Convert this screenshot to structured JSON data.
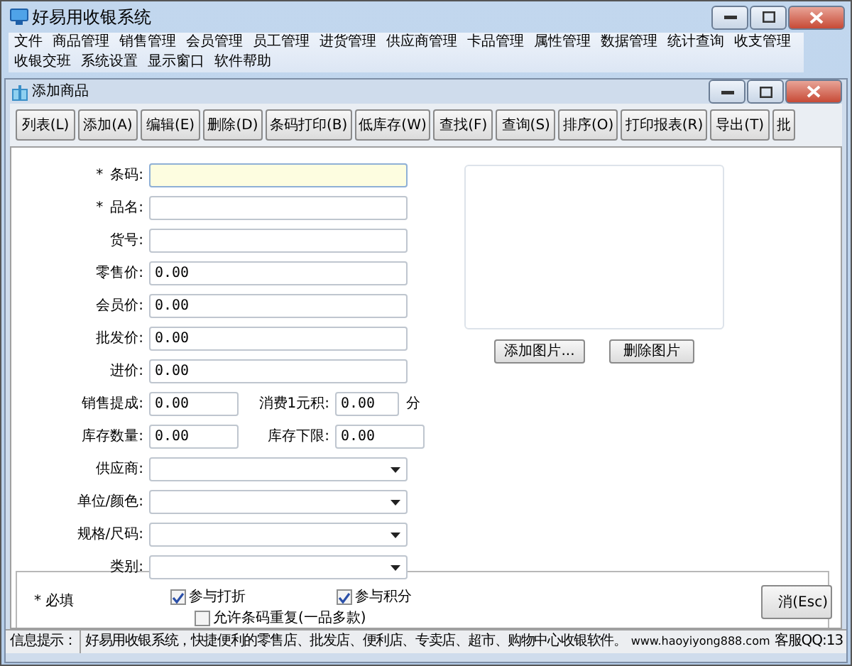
{
  "app_window": {
    "title": "好易用收银系统"
  },
  "menu_rows": [
    [
      "文件",
      "商品管理",
      "销售管理",
      "会员管理",
      "员工管理",
      "进货管理",
      "供应商管理",
      "卡品管理",
      "属性管理",
      "数据管理",
      "统计查询",
      "收支管理"
    ],
    [
      "收银交班",
      "系统设置",
      "显示窗口",
      "软件帮助"
    ]
  ],
  "child_window": {
    "title": "添加商品",
    "toolbar": [
      "列表(L)",
      "添加(A)",
      "编辑(E)",
      "删除(D)",
      "条码打印(B)",
      "低库存(W)",
      "查找(F)",
      "查询(S)",
      "排序(O)",
      "打印报表(R)",
      "导出(T)",
      "批"
    ],
    "form_rows": [
      {
        "fields": [
          {
            "marker": "*",
            "label": "条码:",
            "kind": "text",
            "focused": true
          }
        ]
      },
      {
        "fields": [
          {
            "marker": "*",
            "label": "品名:",
            "kind": "text",
            "focused": false
          }
        ]
      },
      {
        "fields": [
          {
            "label": "货号:",
            "kind": "text",
            "focused": false
          }
        ]
      },
      {
        "fields": [
          {
            "label": "零售价:",
            "kind": "text",
            "value": "0.00",
            "focused": false
          }
        ]
      },
      {
        "fields": [
          {
            "label": "会员价:",
            "kind": "text",
            "value": "0.00",
            "focused": false
          }
        ]
      },
      {
        "fields": [
          {
            "label": "批发价:",
            "kind": "text",
            "value": "0.00",
            "focused": false
          }
        ]
      },
      {
        "fields": [
          {
            "label": "进价:",
            "kind": "text",
            "value": "0.00",
            "focused": false
          }
        ]
      },
      {
        "fields": [
          {
            "label": "销售提成:",
            "kind": "short",
            "value": "0.00",
            "focused": false
          },
          {
            "label": "消费1元积:",
            "kind": "tiny",
            "value": "0.00",
            "focused": false,
            "unit": "分"
          }
        ]
      },
      {
        "fields": [
          {
            "label": "库存数量:",
            "kind": "short",
            "value": "0.00",
            "focused": false
          },
          {
            "label": "库存下限:",
            "kind": "short",
            "value": "0.00",
            "focused": false
          }
        ]
      },
      {
        "fields": [
          {
            "label": "供应商:",
            "kind": "select"
          }
        ]
      },
      {
        "fields": [
          {
            "label": "单位/颜色:",
            "kind": "select"
          }
        ]
      },
      {
        "fields": [
          {
            "label": "规格/尺码:",
            "kind": "select"
          }
        ]
      },
      {
        "fields": [
          {
            "label": "类别:",
            "kind": "select"
          }
        ]
      }
    ],
    "checkboxes": [
      {
        "label": "参与打折",
        "checked": true
      },
      {
        "label": "参与积分",
        "checked": true
      },
      {
        "label": "允许条码重复(一品多款)",
        "checked": false
      }
    ],
    "image_buttons": [
      "添加图片...",
      "删除图片"
    ],
    "bottom_panel": {
      "note": "* 必填",
      "cancel_button": "消(Esc)"
    },
    "status_bar": {
      "label": "信息提示：",
      "message": "好易用收银系统，快捷便利的零售店、批发店、便利店、专卖店、超市、购物中心收银软件。",
      "website": "www.haoyiyong888.com",
      "contact": "客服QQ:13"
    }
  }
}
